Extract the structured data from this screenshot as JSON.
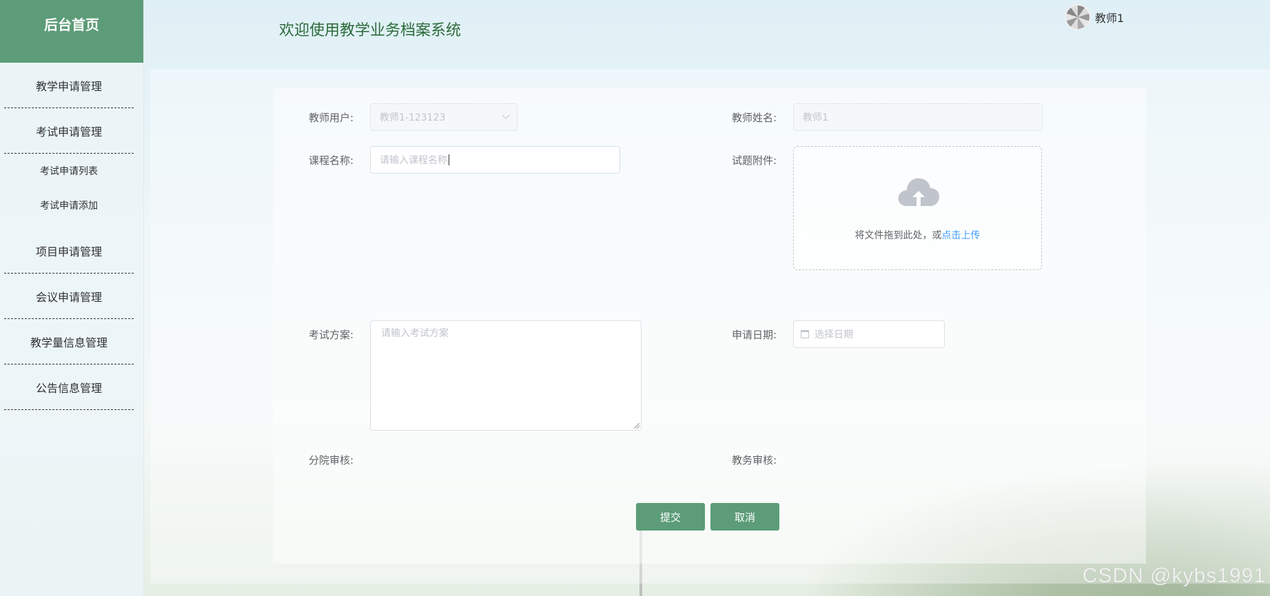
{
  "sidebar": {
    "title": "后台首页",
    "items": [
      {
        "label": "教学申请管理"
      },
      {
        "label": "考试申请管理"
      },
      {
        "label": "考试申请列表"
      },
      {
        "label": "考试申请添加"
      },
      {
        "label": "项目申请管理"
      },
      {
        "label": "会议申请管理"
      },
      {
        "label": "教学量信息管理"
      },
      {
        "label": "公告信息管理"
      }
    ]
  },
  "header": {
    "title": "欢迎使用教学业务档案系统",
    "user_name": "教师1",
    "avatar_icon": "loading-spinner-avatar"
  },
  "form": {
    "teacher_user_label": "教师用户:",
    "teacher_user_value": "教师1-123123",
    "teacher_name_label": "教师姓名:",
    "teacher_name_value": "教师1",
    "course_name_label": "课程名称:",
    "course_name_placeholder": "请输入课程名称",
    "attachment_label": "试题附件:",
    "upload_text": "将文件拖到此处，或",
    "upload_link": "点击上传",
    "exam_plan_label": "考试方案:",
    "exam_plan_placeholder": "请输入考试方案",
    "apply_date_label": "申请日期:",
    "apply_date_placeholder": "选择日期",
    "branch_review_label": "分院审核:",
    "academic_review_label": "教务审核:",
    "submit_label": "提交",
    "cancel_label": "取消"
  },
  "watermark": "CSDN @kybs1991",
  "colors": {
    "accent": "#5c9c78",
    "title": "#2b6a3a",
    "link": "#409eff"
  }
}
